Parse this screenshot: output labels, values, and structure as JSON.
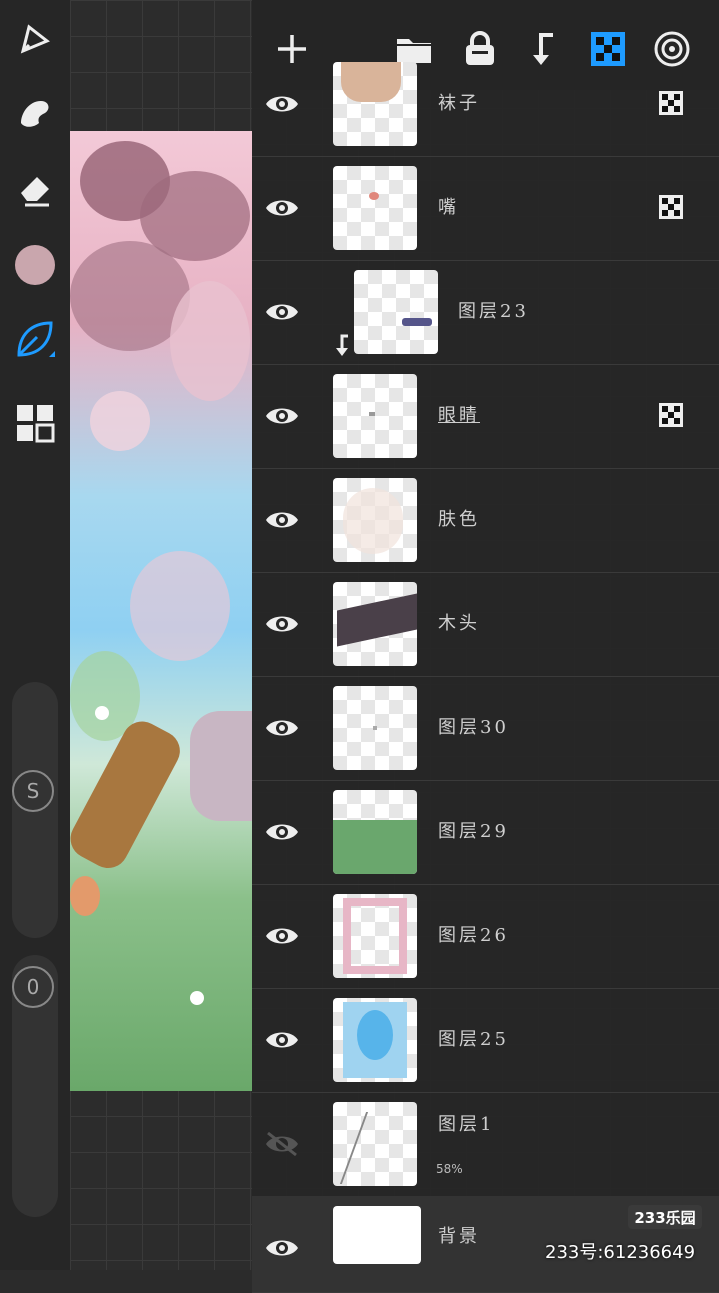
{
  "toolbar": {
    "tools": [
      "brush-icon",
      "smudge-icon",
      "eraser-icon",
      "color-swatch",
      "leaf-brush-icon",
      "gallery-icon"
    ],
    "color": "#c9a6ad",
    "accent": "#1e9bff",
    "size_label": "S",
    "opacity_label": "0"
  },
  "header": {
    "buttons": [
      "add-icon",
      "folder-icon",
      "lock-icon",
      "clip-icon",
      "alpha-lock-icon",
      "target-icon"
    ]
  },
  "layers": [
    {
      "name": "袜子",
      "visible": true,
      "alpha_lock": true
    },
    {
      "name": "嘴",
      "visible": true,
      "alpha_lock": true
    },
    {
      "name": "图层23",
      "visible": true,
      "clipped": true
    },
    {
      "name": "眼睛",
      "visible": true,
      "alpha_lock": true,
      "active_underline": true
    },
    {
      "name": "肤色",
      "visible": true
    },
    {
      "name": "木头",
      "visible": true
    },
    {
      "name": "图层30",
      "visible": true
    },
    {
      "name": "图层29",
      "visible": true
    },
    {
      "name": "图层26",
      "visible": true
    },
    {
      "name": "图层25",
      "visible": true
    },
    {
      "name": "图层1",
      "visible": false,
      "opacity": "58%"
    },
    {
      "name": "背景",
      "visible": true
    }
  ],
  "watermark": {
    "logo": "233乐园",
    "id": "233号:61236649"
  }
}
